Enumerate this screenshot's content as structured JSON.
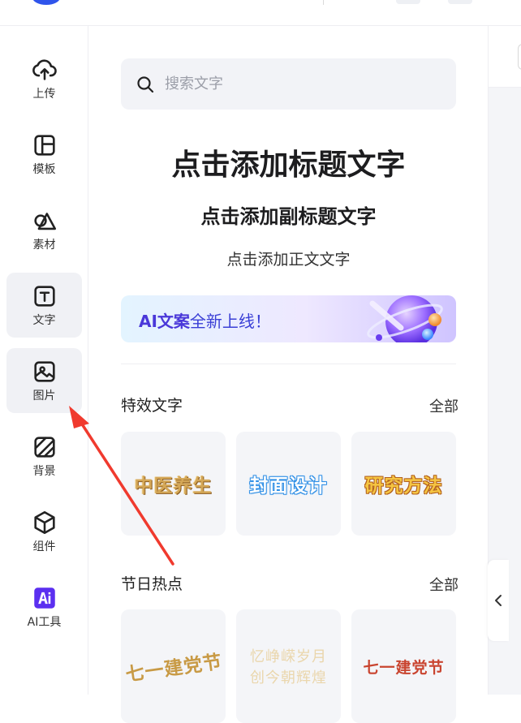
{
  "sidebar": {
    "items": [
      {
        "label": "上传",
        "icon": "upload-cloud-icon"
      },
      {
        "label": "模板",
        "icon": "template-icon"
      },
      {
        "label": "素材",
        "icon": "shapes-icon"
      },
      {
        "label": "文字",
        "icon": "text-icon"
      },
      {
        "label": "图片",
        "icon": "image-icon"
      },
      {
        "label": "背景",
        "icon": "background-icon"
      },
      {
        "label": "组件",
        "icon": "component-icon"
      },
      {
        "label": "AI工具",
        "icon": "ai-tools-icon"
      }
    ],
    "active_index": 3,
    "hover_index": 4
  },
  "search": {
    "placeholder": "搜索文字"
  },
  "text_presets": {
    "title": "点击添加标题文字",
    "subtitle": "点击添加副标题文字",
    "body": "点击添加正文文字"
  },
  "banner": {
    "ai_part": "AI文案",
    "rest": "全新上线！"
  },
  "effects_section": {
    "title": "特效文字",
    "all_label": "全部",
    "cards": [
      "中医养生",
      "封面设计",
      "研究方法"
    ]
  },
  "festival_section": {
    "title": "节日热点",
    "all_label": "全部",
    "cards": [
      "七一建党节",
      "忆峥嵘岁月 创今朝辉煌",
      "七一建党节"
    ]
  },
  "colors": {
    "accent": "#4a38d9",
    "annotation_arrow": "#f03a2e",
    "active_bg": "#f0f1f5"
  }
}
